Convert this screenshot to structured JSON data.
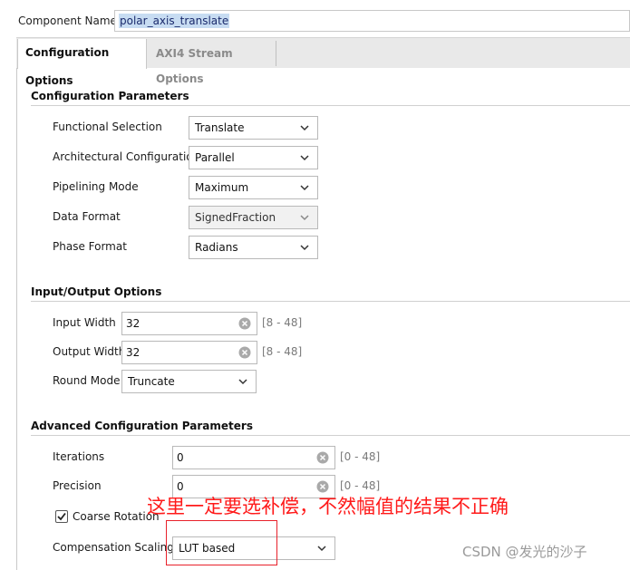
{
  "component": {
    "label": "Component Name",
    "value": "polar_axis_translate"
  },
  "tabs": [
    {
      "label": "Configuration Options",
      "active": true
    },
    {
      "label": "AXI4 Stream Options",
      "active": false
    }
  ],
  "config_params": {
    "title": "Configuration Parameters",
    "fields": [
      {
        "label": "Functional Selection",
        "value": "Translate",
        "disabled": false
      },
      {
        "label": "Architectural Configuration",
        "value": "Parallel",
        "disabled": false
      },
      {
        "label": "Pipelining Mode",
        "value": "Maximum",
        "disabled": false
      },
      {
        "label": "Data Format",
        "value": "SignedFraction",
        "disabled": true
      },
      {
        "label": "Phase Format",
        "value": "Radians",
        "disabled": false
      }
    ]
  },
  "io_options": {
    "title": "Input/Output Options",
    "input_width": {
      "label": "Input Width",
      "value": "32",
      "range": "[8 - 48]"
    },
    "output_width": {
      "label": "Output Width",
      "value": "32",
      "range": "[8 - 48]"
    },
    "round_mode": {
      "label": "Round Mode",
      "value": "Truncate"
    }
  },
  "advanced": {
    "title": "Advanced Configuration Parameters",
    "iterations": {
      "label": "Iterations",
      "value": "0",
      "range": "[0 - 48]"
    },
    "precision": {
      "label": "Precision",
      "value": "0",
      "range": "[0 - 48]"
    },
    "coarse_rotation": {
      "label": "Coarse Rotation",
      "checked": true
    },
    "compensation": {
      "label": "Compensation Scaling",
      "value": "LUT based"
    }
  },
  "annotation": {
    "text": "这里一定要选补偿，不然幅值的结果不正确",
    "color": "#ff1a1a"
  },
  "watermark": "CSDN @发光的沙子",
  "colors": {
    "selection": "#c7dcf2",
    "tab_inactive_text": "#8a8a8a"
  }
}
